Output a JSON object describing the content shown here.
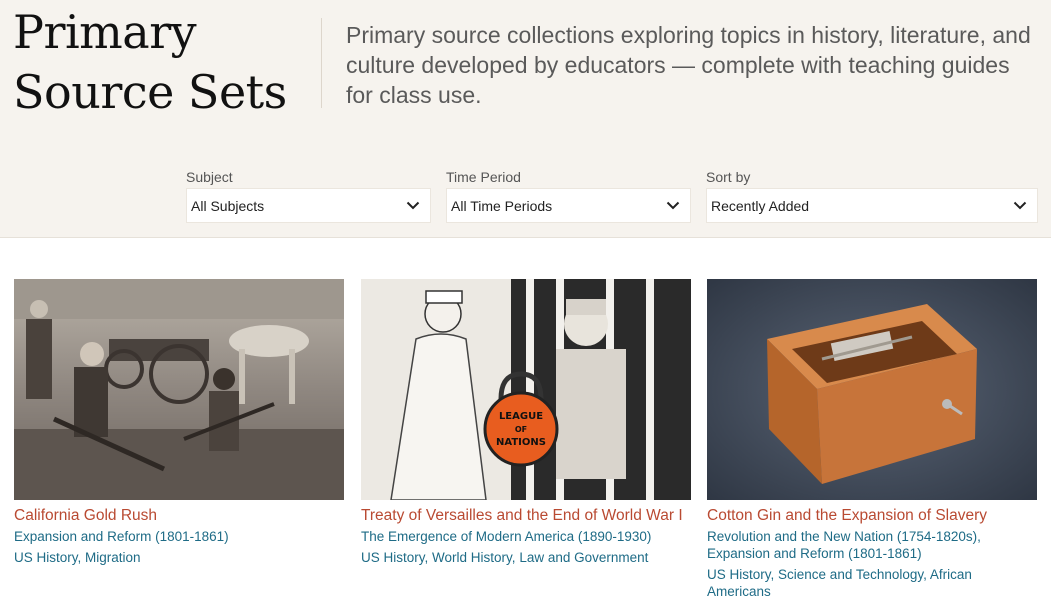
{
  "header": {
    "title": "Primary Source Sets",
    "description": "Primary source collections exploring topics in history, literature, and culture developed by educators — complete with teaching guides for class use."
  },
  "filters": [
    {
      "label": "Subject",
      "value": "All Subjects",
      "icon": "chevron-down-icon"
    },
    {
      "label": "Time Period",
      "value": "All Time Periods",
      "icon": "chevron-down-icon"
    },
    {
      "label": "Sort by",
      "value": "Recently Added",
      "icon": "chevron-down-icon"
    }
  ],
  "colors": {
    "hero_bg": "#f6f3ee",
    "title_link": "#b94a32",
    "meta_link": "#1e6b86"
  },
  "cards": [
    {
      "title": "California Gold Rush",
      "periods": [
        "Expansion and Reform (1801-1861)"
      ],
      "tags": [
        "US History",
        "Migration"
      ],
      "image": "sepia photograph of miners with shovels and a horse-drawn wagon"
    },
    {
      "title": "Treaty of Versailles and the End of World War I",
      "periods": [
        "The Emergence of Modern America (1890-1930)"
      ],
      "tags": [
        "US History",
        "World History",
        "Law and Government"
      ],
      "image": "political cartoon of Victory with League of Nations padlock and War behind bars"
    },
    {
      "title": "Cotton Gin and the Expansion of Slavery",
      "periods": [
        "Revolution and the New Nation (1754-1820s)",
        "Expansion and Reform (1801-1861)"
      ],
      "tags": [
        "US History",
        "Science and Technology",
        "African Americans"
      ],
      "image": "wooden cotton gin model on gray background"
    }
  ]
}
